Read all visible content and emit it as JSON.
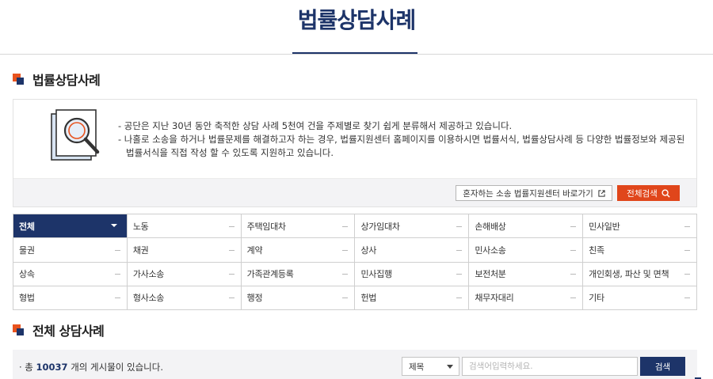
{
  "page": {
    "title": "법률상담사례"
  },
  "section1": {
    "title": "법률상담사례"
  },
  "intro": {
    "lines": [
      "- 공단은 지난 30년 동안 축적한 상담 사례 5천여 건을 주제별로 찾기 쉽게 분류해서 제공하고 있습니다.",
      "- 나홀로 소송을 하거나 법률문제를 해결하고자 하는 경우, 법률지원센터 홈페이지를 이용하시면 법률서식, 법률상담사례 등 다양한 법률정보와 제공된 법률서식을 직접 작성 할 수 있도록 지원하고 있습니다."
    ],
    "self_help_label": "혼자하는 소송 법률지원센터 바로가기",
    "search_all_label": "전체검색"
  },
  "categories": [
    "전체",
    "노동",
    "주택임대차",
    "상가임대차",
    "손해배상",
    "민사일반",
    "물권",
    "채권",
    "계약",
    "상사",
    "민사소송",
    "친족",
    "상속",
    "가사소송",
    "가족관계등록",
    "민사집행",
    "보전처분",
    "개인회생, 파산 및 면책",
    "형법",
    "형사소송",
    "행정",
    "헌법",
    "채무자대리",
    "기타"
  ],
  "active_category": "전체",
  "section2": {
    "title": "전체 상담사례"
  },
  "list": {
    "total_prefix": "· 총 ",
    "total_count": "10037",
    "total_suffix": " 개의 게시물이 있습니다.",
    "search_field": "제목",
    "search_placeholder": "검색어입력하세요.",
    "search_label": "검색"
  },
  "colors": {
    "navy": "#1d3469",
    "orange": "#e8531e"
  }
}
